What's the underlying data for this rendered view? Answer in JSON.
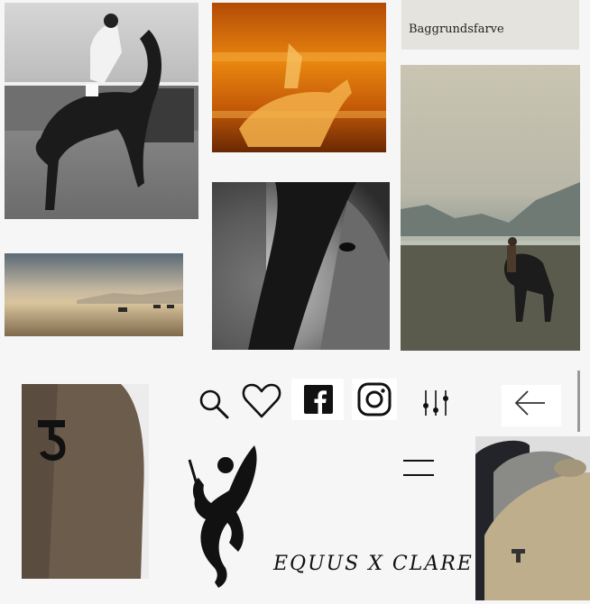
{
  "swatch": {
    "label": "Baggrundsfarve",
    "color": "#e5e3de"
  },
  "brand": {
    "name": "EQUUS X CLARE"
  },
  "toolbar": {
    "icons": [
      "search-icon",
      "heart-icon",
      "facebook-icon",
      "instagram-icon",
      "sliders-icon",
      "arrow-left-icon",
      "hamburger-menu-icon"
    ]
  },
  "colors": {
    "icon": "#111111",
    "page_background": "#f6f6f6"
  }
}
